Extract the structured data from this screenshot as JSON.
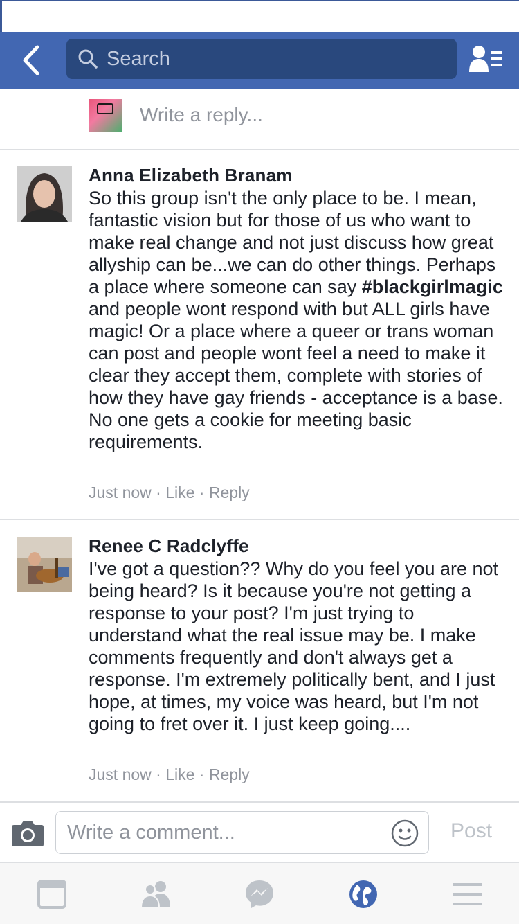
{
  "search": {
    "placeholder": "Search"
  },
  "reply": {
    "placeholder": "Write a reply..."
  },
  "comments": [
    {
      "author": "Anna Elizabeth Branam",
      "text_before": "So this group isn't the only place to be. I mean, fantastic vision but for those of us who want to make real change and not just discuss how great allyship can be...we can do other things. Perhaps a place where someone can say ",
      "hashtag": "#blackgirlmagic",
      "text_after": " and people wont respond with but ALL girls have magic! Or a place where a queer or trans woman can post and people wont feel a need to make it clear they accept them, complete with stories of how they have gay friends - acceptance is a base. No one gets a cookie for meeting basic requirements.",
      "time": "Just now",
      "like": "Like",
      "reply": "Reply"
    },
    {
      "author": "Renee C Radclyffe",
      "text": "I've got a question??  Why do you feel you are not being heard?  Is it because you're not getting a response to your post?  I'm just trying to understand what the real issue may be.  I make comments frequently and don't always get a response.  I'm extremely politically bent, and I just hope, at times, my voice was heard, but I'm not going to fret over it.  I just keep going....",
      "time": "Just now",
      "like": "Like",
      "reply": "Reply"
    }
  ],
  "composer": {
    "placeholder": "Write a comment...",
    "post_label": "Post"
  },
  "separator": " · ",
  "colors": {
    "brand": "#4267b2",
    "search_bg": "#29487d",
    "active_tab": "#4267b2",
    "muted": "#90949c"
  },
  "tabs": [
    {
      "icon": "news-feed-icon",
      "active": false
    },
    {
      "icon": "friends-icon",
      "active": false
    },
    {
      "icon": "messenger-icon",
      "active": false
    },
    {
      "icon": "globe-notifications-icon",
      "active": true
    },
    {
      "icon": "menu-icon",
      "active": false
    }
  ]
}
